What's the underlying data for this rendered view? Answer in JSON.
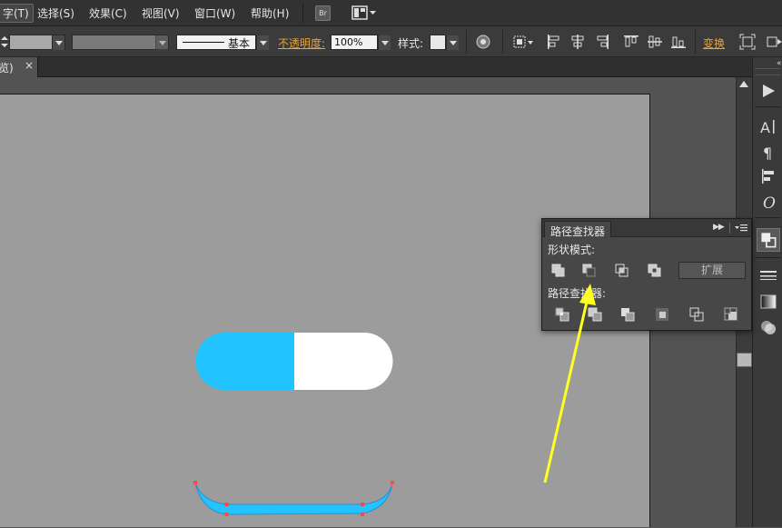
{
  "menubar": {
    "items": [
      "字(T)",
      "选择(S)",
      "效果(C)",
      "视图(V)",
      "窗口(W)",
      "帮助(H)"
    ],
    "br_label": "Br"
  },
  "controlbar": {
    "stroke_style_label": "基本",
    "opacity_label": "不透明度:",
    "opacity_value": "100%",
    "style_label": "样式:",
    "transform_label": "变换"
  },
  "tabbar": {
    "tab_label": "览)",
    "close_glyph": "×"
  },
  "pathfinder": {
    "tab_title": "路径查找器",
    "shape_modes_label": "形状模式:",
    "expand_button": "扩展",
    "pathfinders_label": "路径查找器:",
    "shape_modes": [
      "unite-icon",
      "minus-front-icon",
      "intersect-icon",
      "exclude-icon"
    ],
    "pathfinder_ops": [
      "divide-icon",
      "trim-icon",
      "merge-icon",
      "crop-icon",
      "outline-icon",
      "minus-back-icon"
    ]
  },
  "canvas": {
    "capsule_left_color": "#22c3ff",
    "capsule_right_color": "#ffffff",
    "arrow_color": "#ffff22"
  },
  "colors": {
    "accent_orange": "#e8a23a",
    "artboard_bg": "#9c9c9c",
    "selection_anchor": "#ff4444"
  }
}
